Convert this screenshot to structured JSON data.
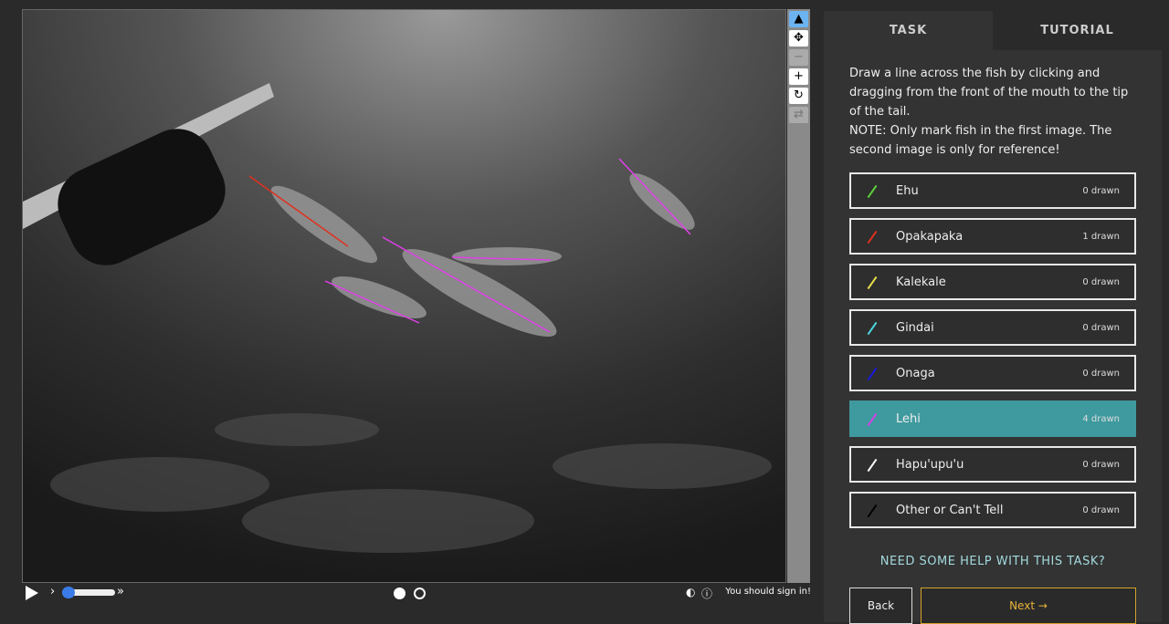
{
  "tabs": {
    "task": "TASK",
    "tutorial": "TUTORIAL"
  },
  "instructions": [
    "Draw a line across the fish by clicking and dragging from the front of the mouth to the tip of the tail.",
    "NOTE: Only mark fish in the first image. The second image is only for reference!"
  ],
  "choices": [
    {
      "label": "Ehu",
      "count": "0 drawn",
      "color": "#5ed23a"
    },
    {
      "label": "Opakapaka",
      "count": "1 drawn",
      "color": "#e0301e"
    },
    {
      "label": "Kalekale",
      "count": "0 drawn",
      "color": "#e8e04a"
    },
    {
      "label": "Gindai",
      "count": "0 drawn",
      "color": "#4ad8e0"
    },
    {
      "label": "Onaga",
      "count": "0 drawn",
      "color": "#1a1ae0"
    },
    {
      "label": "Lehi",
      "count": "4 drawn",
      "color": "#d040e0",
      "selected": true
    },
    {
      "label": "Hapu'upu'u",
      "count": "0 drawn",
      "color": "#ffffff"
    },
    {
      "label": "Other or Can't Tell",
      "count": "0 drawn",
      "color": "#000000"
    }
  ],
  "help": "NEED SOME HELP WITH THIS TASK?",
  "back": "Back",
  "next": "Next →",
  "signin": "You should sign in!",
  "toolbar": {
    "pointer": "▲",
    "move": "✥",
    "zoom_out": "−",
    "zoom_in": "+",
    "rotate": "↻",
    "reset": "⇄"
  }
}
